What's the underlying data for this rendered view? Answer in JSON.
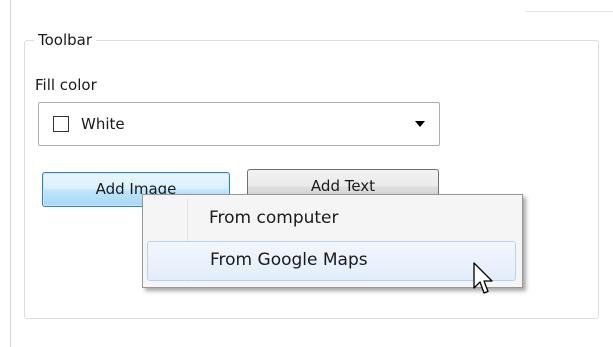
{
  "groupbox": {
    "legend": "Toolbar"
  },
  "fill_color": {
    "label": "Fill color",
    "selected_value": "White"
  },
  "buttons": {
    "add_image": "Add Image",
    "add_text": "Add Text"
  },
  "context_menu": {
    "items": [
      {
        "label": "From computer"
      },
      {
        "label": "From Google Maps"
      }
    ]
  },
  "colors": {
    "button_focus_border": "#3c7fb1",
    "menu_hover_border": "#b7d1ee"
  },
  "icons": {
    "dropdown": "dropdown-arrow-icon",
    "cursor": "mouse-pointer-icon",
    "swatch": "color-swatch-icon"
  }
}
